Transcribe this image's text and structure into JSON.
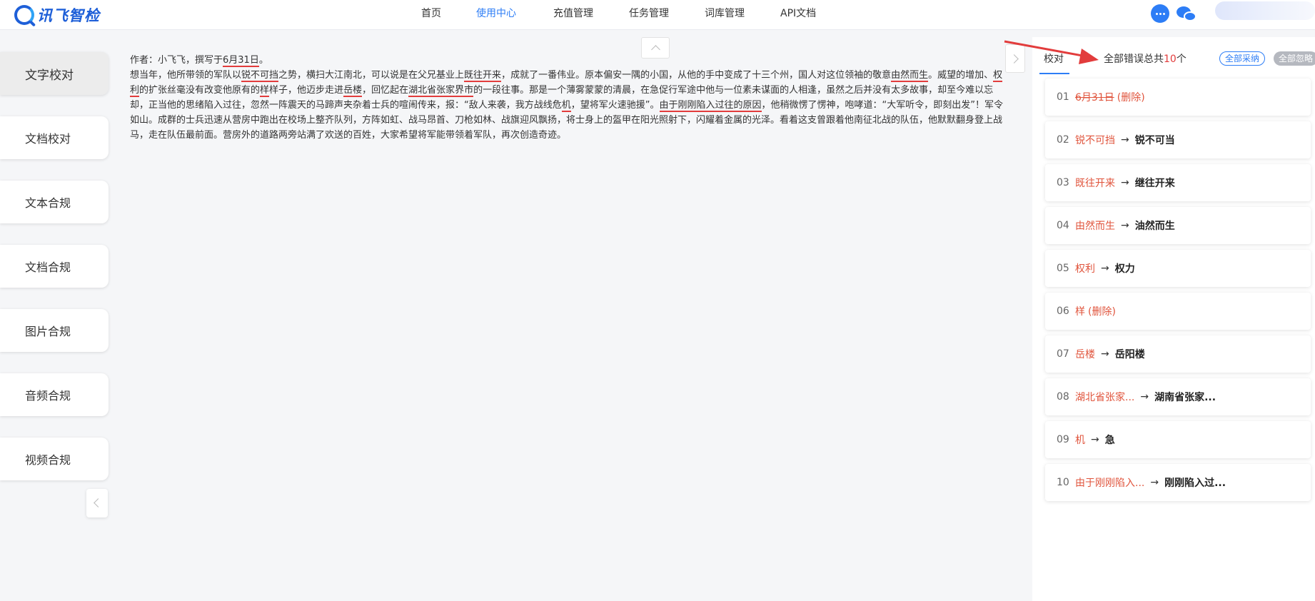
{
  "brand": {
    "logo_text": "讯飞智检"
  },
  "nav": {
    "items": [
      {
        "label": "首页",
        "active": false
      },
      {
        "label": "使用中心",
        "active": true
      },
      {
        "label": "充值管理",
        "active": false
      },
      {
        "label": "任务管理",
        "active": false
      },
      {
        "label": "词库管理",
        "active": false
      },
      {
        "label": "API文档",
        "active": false
      }
    ]
  },
  "header_icons": [
    "customer-service-icon",
    "wechat-icon",
    "user-avatar"
  ],
  "sidebar": {
    "items": [
      {
        "label": "文字校对",
        "active": true
      },
      {
        "label": "文档校对",
        "active": false
      },
      {
        "label": "文本合规",
        "active": false
      },
      {
        "label": "文档合规",
        "active": false
      },
      {
        "label": "图片合规",
        "active": false
      },
      {
        "label": "音频合规",
        "active": false
      },
      {
        "label": "视频合规",
        "active": false
      }
    ]
  },
  "document": {
    "author_prefix": "作者：小飞飞，撰写于",
    "author_date": "6月31日",
    "author_suffix": "。",
    "segments": [
      {
        "t": "想当年，他所带领的军队以"
      },
      {
        "t": "锐不可挡",
        "e": true
      },
      {
        "t": "之势，横扫大江南北，可以说是在父兄基业上"
      },
      {
        "t": "既往开来",
        "e": true
      },
      {
        "t": "，成就了一番伟业。原本偏安一隅的小国，从他的手中变成了十三个州，国人对这位领袖的敬意"
      },
      {
        "t": "由然而生",
        "e": true
      },
      {
        "t": "。威望的增加、"
      },
      {
        "t": "权利",
        "e": true
      },
      {
        "t": "的扩张丝毫没有改变他原有的"
      },
      {
        "t": "样",
        "e": true
      },
      {
        "t": "样子，他迈步走进"
      },
      {
        "t": "岳楼",
        "e": true
      },
      {
        "t": "，回忆起在"
      },
      {
        "t": "湖北省张家界市",
        "e": true
      },
      {
        "t": "的一段往事。那是一个薄雾蒙蒙的清晨，在急促行军途中他与一位素未谋面的人相逢，虽然之后并没有太多故事，却至今难以忘却，正当他的思绪陷入过往，忽然一阵震天的马蹄声夹杂着士兵的喧闹传来，报：“敌人来袭，我方战线危"
      },
      {
        "t": "机",
        "e": true
      },
      {
        "t": "，望将军火速驰援”。"
      },
      {
        "t": "由于刚刚陷入过往的原因",
        "e": true
      },
      {
        "t": "，他稍微愣了愣神，咆哮道：“大军听令，即刻出发”！军令如山。成群的士兵迅速从营房中跑出在校场上整齐队列，方阵如虹、战马昂首、刀枪如林、战旗迎风飘扬，将士身上的盔甲在阳光照射下，闪耀着金属的光泽。看着这支曾跟着他南征北战的队伍，他默默翻身登上战马，走在队伍最前面。营房外的道路两旁站满了欢送的百姓，大家希望将军能带领着军队，再次创造奇迹。"
      }
    ]
  },
  "panel": {
    "tab_label": "校对",
    "summary_prefix": "全部错误总共",
    "summary_count": "10",
    "summary_suffix": "个",
    "accept_all": "全部采纳",
    "ignore_all": "全部忽略",
    "arrow_color": "#e23c3c",
    "corrections": [
      {
        "num": "01",
        "wrong": "6月31日",
        "strike": true,
        "note": "(删除)",
        "fix": ""
      },
      {
        "num": "02",
        "wrong": "锐不可挡",
        "strike": false,
        "note": "",
        "fix": "锐不可当"
      },
      {
        "num": "03",
        "wrong": "既往开来",
        "strike": false,
        "note": "",
        "fix": "继往开来"
      },
      {
        "num": "04",
        "wrong": "由然而生",
        "strike": false,
        "note": "",
        "fix": "油然而生"
      },
      {
        "num": "05",
        "wrong": "权利",
        "strike": false,
        "note": "",
        "fix": "权力"
      },
      {
        "num": "06",
        "wrong": "样",
        "strike": false,
        "note": "(删除)",
        "fix": ""
      },
      {
        "num": "07",
        "wrong": "岳楼",
        "strike": false,
        "note": "",
        "fix": "岳阳楼"
      },
      {
        "num": "08",
        "wrong": "湖北省张家...",
        "strike": false,
        "note": "",
        "fix": "湖南省张家..."
      },
      {
        "num": "09",
        "wrong": "机",
        "strike": false,
        "note": "",
        "fix": "急"
      },
      {
        "num": "10",
        "wrong": "由于刚刚陷入...",
        "strike": false,
        "note": "",
        "fix": "刚刚陷入过..."
      }
    ]
  }
}
